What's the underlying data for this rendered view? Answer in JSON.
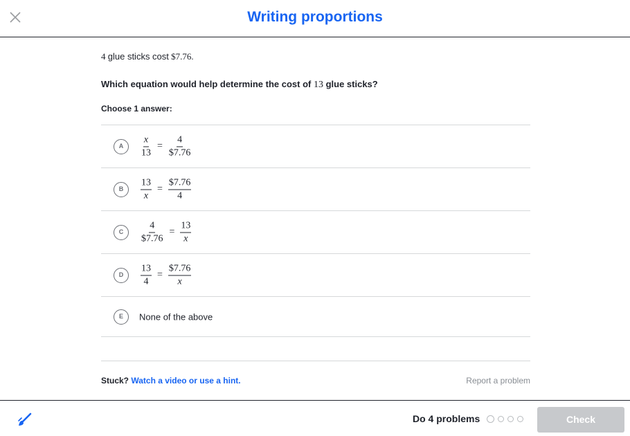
{
  "header": {
    "title": "Writing proportions",
    "close_icon": "close-icon"
  },
  "problem": {
    "count": "4",
    "text": "glue sticks cost",
    "price": "$7.76."
  },
  "question": {
    "prefix": "Which equation would help determine the cost of",
    "number": "13",
    "suffix": "glue sticks?"
  },
  "choose_label": "Choose 1 answer:",
  "choices": [
    {
      "letter": "A",
      "lhs_num": "x",
      "lhs_den": "13",
      "rhs_num": "4",
      "rhs_den": "$7.76"
    },
    {
      "letter": "B",
      "lhs_num": "13",
      "lhs_den": "x",
      "rhs_num": "$7.76",
      "rhs_den": "4"
    },
    {
      "letter": "C",
      "lhs_num": "4",
      "lhs_den": "$7.76",
      "rhs_num": "13",
      "rhs_den": "x"
    },
    {
      "letter": "D",
      "lhs_num": "13",
      "lhs_den": "4",
      "rhs_num": "$7.76",
      "rhs_den": "x"
    },
    {
      "letter": "E",
      "text": "None of the above"
    }
  ],
  "equals": "=",
  "help": {
    "stuck": "Stuck?",
    "link": "Watch a video or use a hint.",
    "report": "Report a problem"
  },
  "footer": {
    "do_label": "Do 4 problems",
    "progress_total": 4,
    "progress_done": 0,
    "check_label": "Check",
    "scratchpad_icon": "scratchpad-icon",
    "colors": {
      "accent": "#1865f2",
      "check_disabled": "#c7c9cc"
    }
  }
}
